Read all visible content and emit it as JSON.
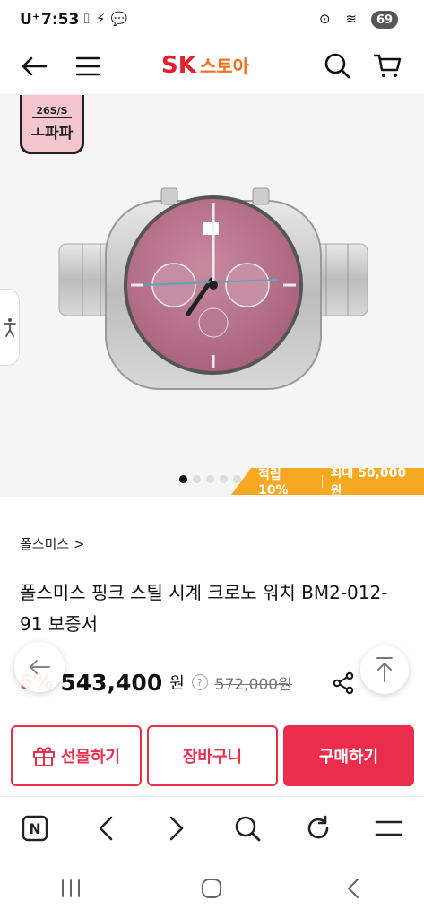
{
  "status_bar": {
    "carrier": "U⁺",
    "time": "7:53",
    "left_icons": "⌷⚡💬",
    "right_icons": "⊙ ≋ ıl",
    "battery": "69"
  },
  "header": {
    "logo_sk": "SK",
    "logo_store": "스토아"
  },
  "product_image": {
    "badge_season": "26S/S",
    "badge_name": "ㅗ파파",
    "carousel_count": 5,
    "carousel_active_index": 0,
    "promo_points": "적립 10%",
    "promo_max": "최대 50,000원",
    "promo_color": "#f7a823"
  },
  "product": {
    "brand_crumb": "폴스미스 >",
    "title": "폴스미스 핑크 스틸 시계 크로노 워치 BM2-012-91 보증서",
    "discount": "5%",
    "price": "543,400",
    "price_unit": "원",
    "help": "?",
    "original_price": "572,000원"
  },
  "actions": {
    "gift_label": "선물하기",
    "cart_label": "장바구니",
    "buy_label": "구매하기",
    "accent": "#ea2d4b"
  },
  "toolbar": {
    "home_letter": "N"
  }
}
